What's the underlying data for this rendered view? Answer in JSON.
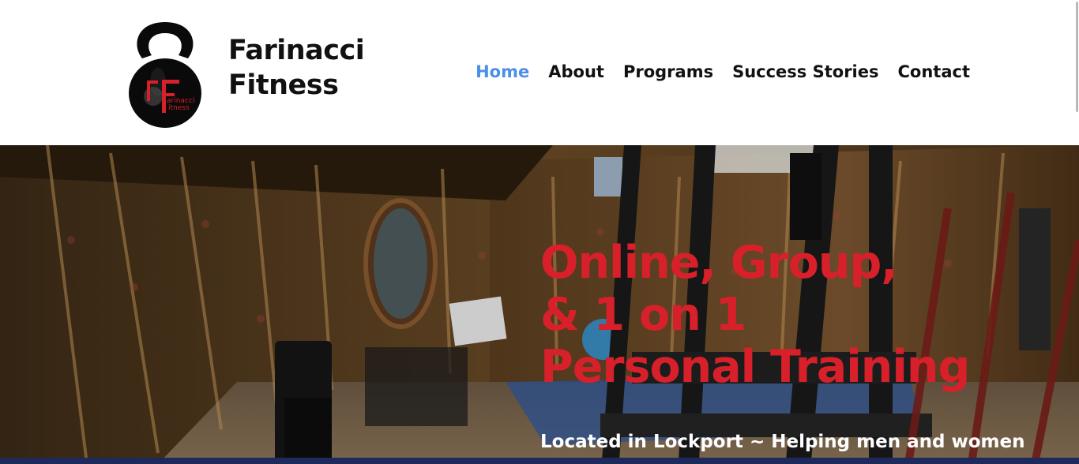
{
  "header": {
    "brand_line1": "Farinacci",
    "brand_line2": "Fitness",
    "logo_text_top": "arinacci",
    "logo_text_bottom": "itness"
  },
  "nav": {
    "items": [
      {
        "label": "Home",
        "active": true
      },
      {
        "label": "About",
        "active": false
      },
      {
        "label": "Programs",
        "active": false
      },
      {
        "label": "Success Stories",
        "active": false
      },
      {
        "label": "Contact",
        "active": false
      }
    ]
  },
  "hero": {
    "title_line1": "Online, Group,",
    "title_line2": "& 1 on 1",
    "title_line3": "Personal Training",
    "subtitle": "Located in Lockport ~ Helping men and women"
  },
  "colors": {
    "accent_nav": "#4a8fe8",
    "hero_title": "#d8202a",
    "footer_bar": "#1d2a5b"
  }
}
